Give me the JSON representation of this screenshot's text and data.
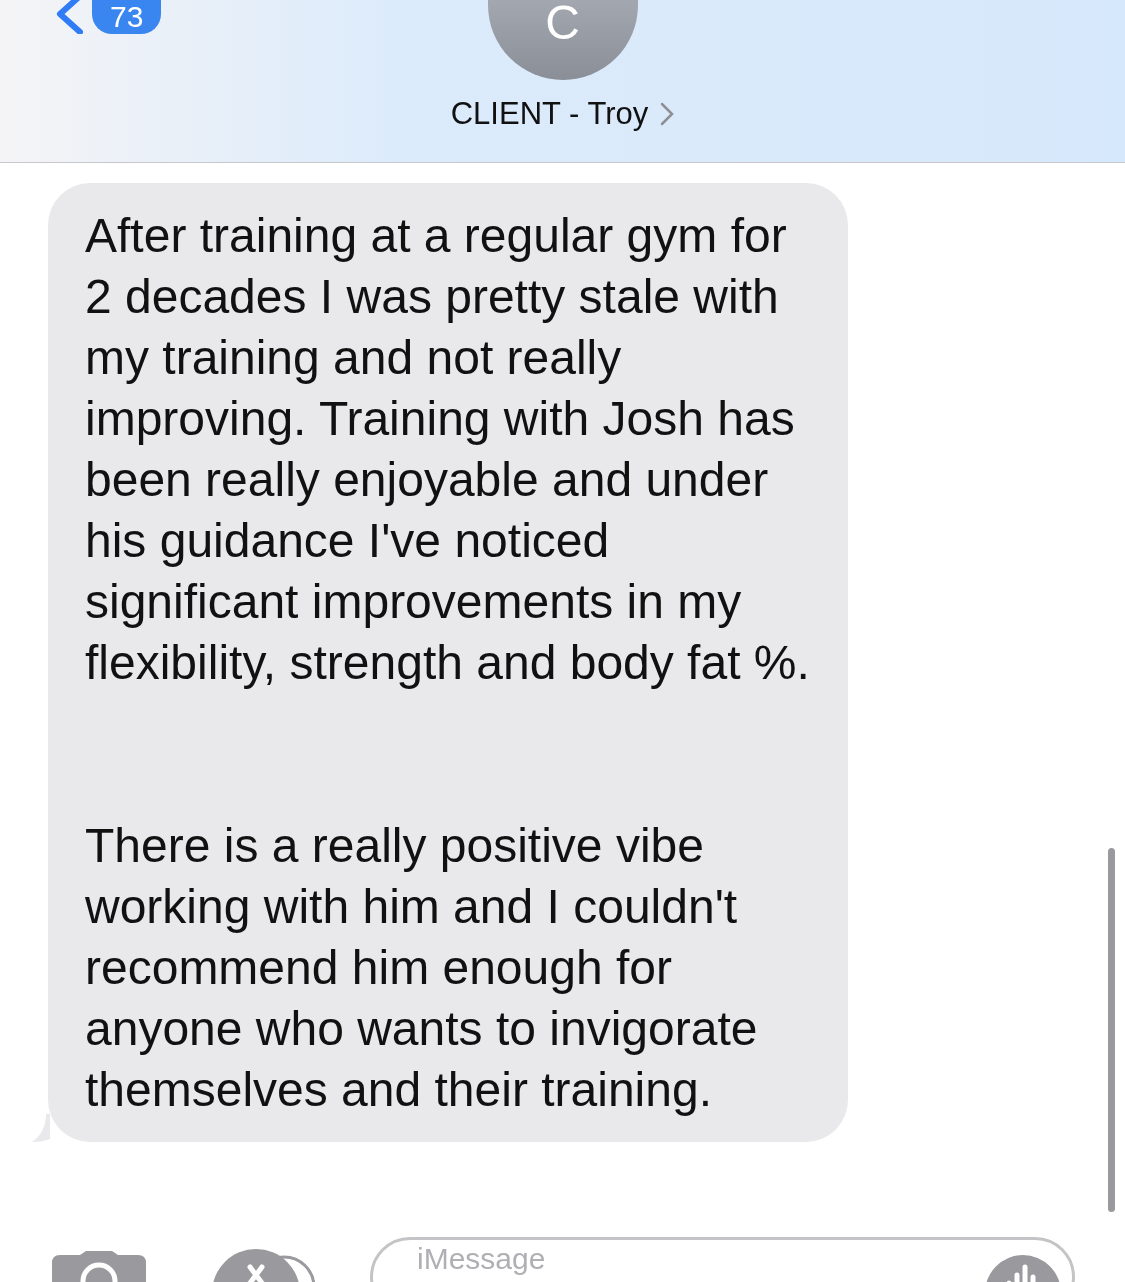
{
  "header": {
    "back_badge": "73",
    "avatar_initial": "C",
    "contact_name": "CLIENT - Troy"
  },
  "messages": [
    {
      "kind": "received",
      "paragraphs": [
        "After training at a regular gym for 2 decades I was pretty stale with my training and not really improving.  Training with Josh has been really enjoyable and under his guidance I've noticed significant improvements in my flexibility, strength and body fat %.",
        "There is a really positive vibe working with him and I couldn't recommend him enough for anyone who wants to invigorate themselves and their training."
      ]
    }
  ],
  "composer": {
    "placeholder": "iMessage"
  }
}
